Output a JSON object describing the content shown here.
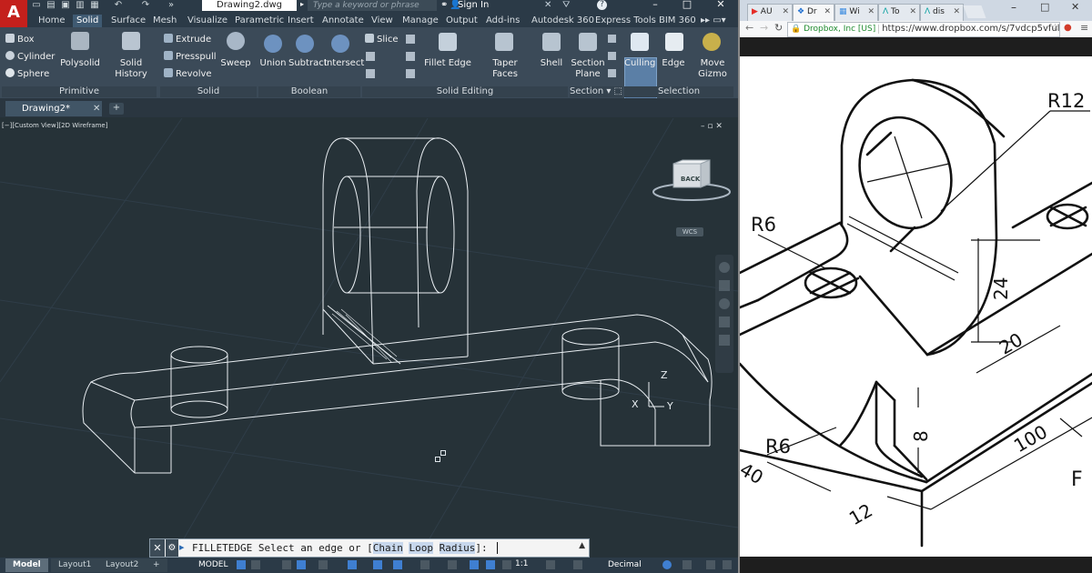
{
  "autocad": {
    "app_letter": "A",
    "file_title": "Drawing2.dwg",
    "search_placeholder": "Type a keyword or phrase",
    "sign_in": "Sign In",
    "ribbon_tabs": [
      "Home",
      "Solid",
      "Surface",
      "Mesh",
      "Visualize",
      "Parametric",
      "Insert",
      "Annotate",
      "View",
      "Manage",
      "Output",
      "Add-ins",
      "Autodesk 360",
      "Express Tools",
      "BIM 360"
    ],
    "active_tab": "Solid",
    "panels": {
      "primitive": {
        "title": "Primitive",
        "buttons": [
          "Box",
          "Cylinder",
          "Sphere"
        ],
        "big": [
          "Polysolid",
          "Solid History"
        ]
      },
      "solid": {
        "title": "Solid",
        "buttons": [
          "Extrude",
          "Presspull",
          "Revolve"
        ],
        "big": [
          "Sweep"
        ]
      },
      "boolean": {
        "title": "Boolean",
        "big": [
          "Union",
          "Subtract",
          "Intersect"
        ]
      },
      "solid_editing": {
        "title": "Solid Editing",
        "buttons": [
          "Slice"
        ],
        "big": [
          "Fillet Edge",
          "Taper Faces",
          "Shell"
        ]
      },
      "section": {
        "title": "Section",
        "big_line1": "Section",
        "big_line2": "Plane"
      },
      "selection": {
        "title": "Selection",
        "big": [
          "Culling",
          "Edge"
        ],
        "gizmo_line1": "Move",
        "gizmo_line2": "Gizmo"
      }
    },
    "doc_tab": "Drawing2*",
    "view_label": "[−][Custom View][2D Wireframe]",
    "viewcube_face": "BACK",
    "wcs_label": "WCS",
    "axis_z": "Z",
    "axis_y": "Y",
    "axis_x": "X",
    "command": {
      "name": "FILLETEDGE",
      "prompt": "Select an edge or [",
      "opt_chain": "Chain",
      "opt_loop": "Loop",
      "opt_radius": "Radius",
      "suffix": "]:"
    },
    "layout_tabs": [
      "Model",
      "Layout1",
      "Layout2"
    ],
    "status_model": "MODEL",
    "status_scale": "1:1",
    "status_units": "Decimal"
  },
  "browser": {
    "tabs": [
      {
        "icon": "youtube-icon",
        "label": "AU"
      },
      {
        "icon": "dropbox-icon",
        "label": "Dr"
      },
      {
        "icon": "windows-icon",
        "label": "Wi"
      },
      {
        "icon": "autodesk-icon",
        "label": "To"
      },
      {
        "icon": "autodesk-icon",
        "label": "dis"
      }
    ],
    "secure_label": "Dropbox, Inc [US]",
    "url": "https://www.dropbox.com/s/7vdcp5vfulxo/"
  },
  "drawing": {
    "dims": {
      "r12": "R12",
      "r6_top": "R6",
      "r6_bottom": "R6",
      "d24": "24",
      "d20": "20",
      "d8": "8",
      "d100": "100",
      "d12": "12",
      "d40": "40",
      "view_f": "F"
    }
  },
  "colors": {
    "autocad_bg": "#263238",
    "ribbon": "#3b4a58",
    "accent_blue": "#5b7fa6",
    "autocad_red": "#c4201c"
  }
}
